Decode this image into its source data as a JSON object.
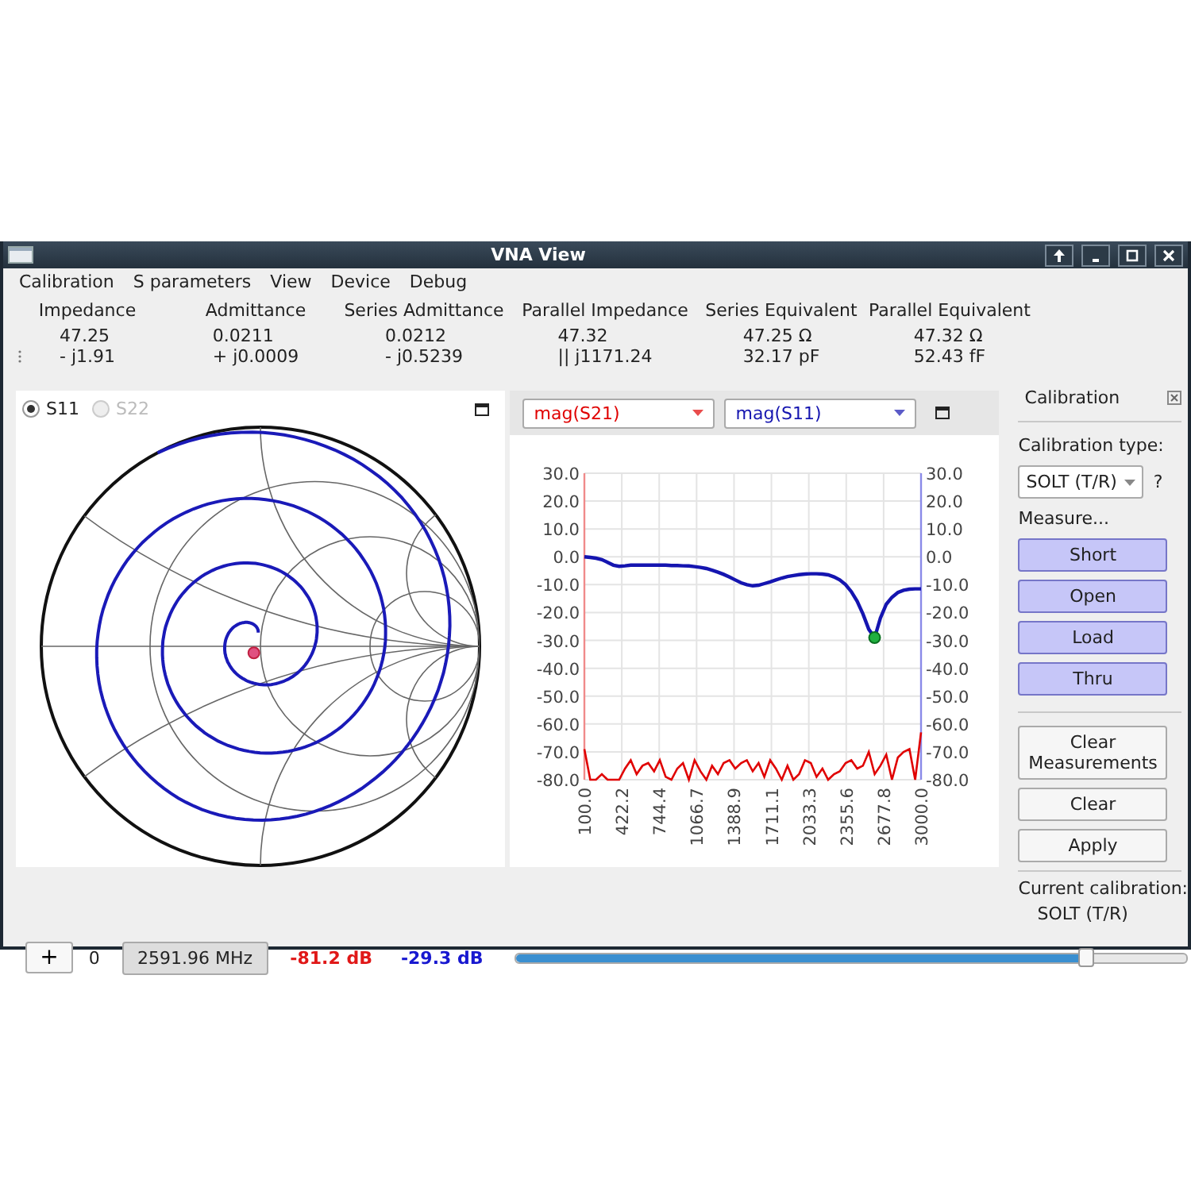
{
  "window": {
    "title": "VNA View"
  },
  "menu": [
    "Calibration",
    "S parameters",
    "View",
    "Device",
    "Debug"
  ],
  "readouts": [
    {
      "label": "Impedance",
      "values": [
        "47.25",
        "- j1.91"
      ]
    },
    {
      "label": "Admittance",
      "values": [
        "0.0211",
        "+ j0.0009"
      ]
    },
    {
      "label": "Series Admittance",
      "values": [
        "0.0212",
        "- j0.5239"
      ]
    },
    {
      "label": "Parallel Impedance",
      "values": [
        "47.32",
        "|| j1171.24"
      ]
    },
    {
      "label": "Series Equivalent",
      "values": [
        "47.25 Ω",
        "32.17 pF"
      ]
    },
    {
      "label": "Parallel Equivalent",
      "values": [
        "47.32 Ω",
        "52.43 fF"
      ]
    }
  ],
  "smith": {
    "ports": [
      {
        "label": "S11",
        "selected": true,
        "disabled": false
      },
      {
        "label": "S22",
        "selected": false,
        "disabled": true
      }
    ]
  },
  "plot": {
    "chart_data": {
      "type": "line",
      "grid": true,
      "x": [
        100,
        150,
        200,
        250,
        300,
        350,
        400,
        450,
        500,
        550,
        600,
        650,
        700,
        750,
        800,
        850,
        900,
        950,
        1000,
        1050,
        1100,
        1150,
        1200,
        1250,
        1300,
        1350,
        1400,
        1450,
        1500,
        1550,
        1600,
        1650,
        1700,
        1750,
        1800,
        1850,
        1900,
        1950,
        2000,
        2050,
        2100,
        2150,
        2200,
        2250,
        2300,
        2350,
        2400,
        2450,
        2500,
        2550,
        2600,
        2650,
        2700,
        2750,
        2800,
        2850,
        2900,
        2950,
        3000
      ],
      "series": [
        {
          "name": "mag(S21)",
          "color": "#e00000",
          "values": [
            -69,
            -80,
            -80,
            -78,
            -80,
            -80,
            -80,
            -76,
            -73,
            -78,
            -75,
            -74,
            -77,
            -73,
            -79,
            -80,
            -76,
            -74,
            -80,
            -73,
            -77,
            -80,
            -75,
            -78,
            -74,
            -73,
            -76,
            -74,
            -73,
            -77,
            -74,
            -79,
            -73,
            -76,
            -80,
            -75,
            -80,
            -78,
            -73,
            -74,
            -79,
            -76,
            -80,
            -78,
            -77,
            -74,
            -73,
            -76,
            -75,
            -70,
            -78,
            -75,
            -71,
            -80,
            -72,
            -70,
            -69,
            -80,
            -63
          ]
        },
        {
          "name": "mag(S11)",
          "color": "#1515b0",
          "values": [
            0,
            -0.2,
            -0.5,
            -1,
            -2,
            -3,
            -3.4,
            -3.2,
            -3,
            -3,
            -3,
            -3,
            -3,
            -3,
            -3,
            -3.1,
            -3.1,
            -3.2,
            -3.3,
            -3.5,
            -3.8,
            -4.2,
            -4.8,
            -5.5,
            -6.3,
            -7.3,
            -8.3,
            -9.3,
            -10,
            -10.4,
            -10.2,
            -9.6,
            -9,
            -8.3,
            -7.6,
            -7.1,
            -6.7,
            -6.4,
            -6.2,
            -6.1,
            -6.1,
            -6.2,
            -6.5,
            -7.2,
            -8.3,
            -10,
            -12.5,
            -16,
            -20.5,
            -26,
            -29,
            -22,
            -17,
            -14.5,
            -12.8,
            -12,
            -11.6,
            -11.5,
            -11.5
          ]
        }
      ],
      "xlim": [
        100,
        3000
      ],
      "ylim": [
        -80,
        30
      ],
      "xticks": [
        {
          "value": 100,
          "label": "100.0"
        },
        {
          "value": 422.2,
          "label": "422.2"
        },
        {
          "value": 744.4,
          "label": "744.4"
        },
        {
          "value": 1066.7,
          "label": "1066.7"
        },
        {
          "value": 1388.9,
          "label": "1388.9"
        },
        {
          "value": 1711.1,
          "label": "1711.1"
        },
        {
          "value": 2033.3,
          "label": "2033.3"
        },
        {
          "value": 2355.6,
          "label": "2355.6"
        },
        {
          "value": 2677.8,
          "label": "2677.8"
        },
        {
          "value": 3000,
          "label": "3000.0"
        }
      ],
      "yticks": [
        {
          "value": 30,
          "label": "30.0"
        },
        {
          "value": 20,
          "label": "20.0"
        },
        {
          "value": 10,
          "label": "10.0"
        },
        {
          "value": 0,
          "label": "0.0"
        },
        {
          "value": -10,
          "label": "-10.0"
        },
        {
          "value": -20,
          "label": "-20.0"
        },
        {
          "value": -30,
          "label": "-30.0"
        },
        {
          "value": -40,
          "label": "-40.0"
        },
        {
          "value": -50,
          "label": "-50.0"
        },
        {
          "value": -60,
          "label": "-60.0"
        },
        {
          "value": -70,
          "label": "-70.0"
        },
        {
          "value": -80,
          "label": "-80.0"
        }
      ]
    }
  },
  "calibration": {
    "title": "Calibration",
    "type_label": "Calibration type:",
    "type_value": "SOLT (T/R)",
    "help": "?",
    "measure_label": "Measure...",
    "measure_buttons": [
      "Short",
      "Open",
      "Load",
      "Thru"
    ],
    "actions": [
      "Clear Measurements",
      "Clear",
      "Apply"
    ],
    "current_label": "Current calibration:",
    "current_value": "SOLT (T/R)"
  },
  "status": {
    "add": "+",
    "index": "0",
    "frequency": "2591.96 MHz",
    "readings": [
      {
        "text": "-81.2 dB",
        "color": "#e01818"
      },
      {
        "text": "-29.3 dB",
        "color": "#1818d0"
      }
    ],
    "sweep": {
      "level": 0.85
    }
  }
}
